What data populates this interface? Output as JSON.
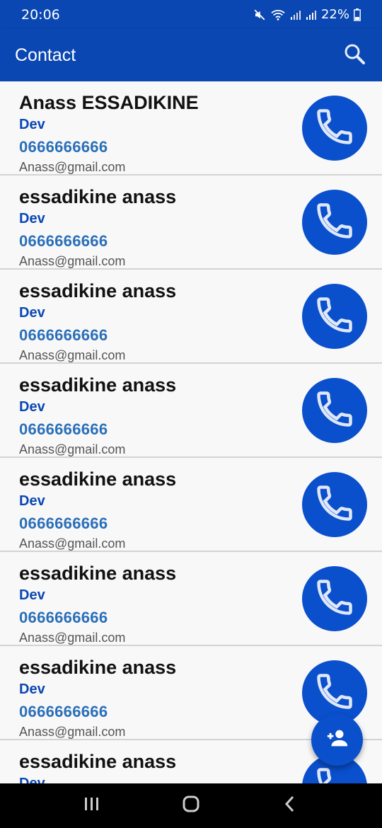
{
  "status": {
    "time": "20:06",
    "battery": "22%",
    "icons": [
      "mute-icon",
      "wifi-icon",
      "signal-icon",
      "signal-icon",
      "battery-icon"
    ]
  },
  "app_bar": {
    "title": "Contact",
    "search_icon": "search-icon"
  },
  "contacts": [
    {
      "name": "Anass ESSADIKINE",
      "role": "Dev",
      "phone": "0666666666",
      "email": "Anass@gmail.com"
    },
    {
      "name": "essadikine anass",
      "role": "Dev",
      "phone": "0666666666",
      "email": "Anass@gmail.com"
    },
    {
      "name": "essadikine anass",
      "role": "Dev",
      "phone": "0666666666",
      "email": "Anass@gmail.com"
    },
    {
      "name": "essadikine anass",
      "role": "Dev",
      "phone": "0666666666",
      "email": "Anass@gmail.com"
    },
    {
      "name": "essadikine anass",
      "role": "Dev",
      "phone": "0666666666",
      "email": "Anass@gmail.com"
    },
    {
      "name": "essadikine anass",
      "role": "Dev",
      "phone": "0666666666",
      "email": "Anass@gmail.com"
    },
    {
      "name": "essadikine anass",
      "role": "Dev",
      "phone": "0666666666",
      "email": "Anass@gmail.com"
    },
    {
      "name": "essadikine anass",
      "role": "Dev",
      "phone": "",
      "email": ""
    }
  ],
  "colors": {
    "primary": "#0a47b2",
    "call_button": "#0a4fcc",
    "role_text": "#0a47b2",
    "phone_text": "#2a6fb8"
  },
  "fab": {
    "icon": "add-person-icon"
  },
  "nav_bar": {
    "icons": [
      "recents-icon",
      "home-icon",
      "back-icon"
    ]
  }
}
